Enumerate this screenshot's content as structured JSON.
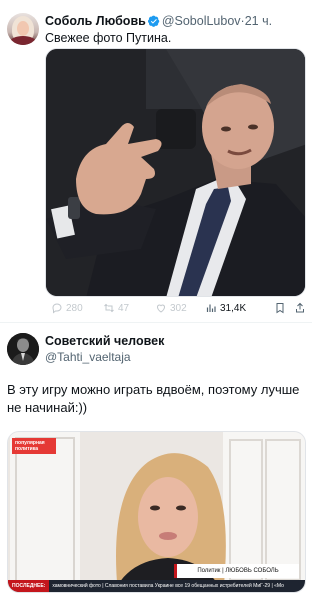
{
  "tweet": {
    "author_name": "Соболь Любовь",
    "handle": "@SobolLubov",
    "dot": "·",
    "time": "21 ч.",
    "text": "Свежее фото Путина.",
    "actions": {
      "reply_count": "280",
      "retweet_count": "47",
      "like_count": "302",
      "views_count": "31,4K"
    },
    "accent_color": "#1d9bf0"
  },
  "post2": {
    "author_name": "Советский человек",
    "handle": "@Tahti_vaeltaja",
    "text": "В эту игру можно играть вдвоём, поэтому лучше не начинай:))",
    "media": {
      "badge": "популярная политика",
      "ticker_label": "ПОСЛЕДНЕЕ:",
      "ticker_text": "хамовнический фото | Славония поставила Украине все 19 обещанных истребителей МиГ-29 | «Мо",
      "lower_third": "Политик | ЛЮБОВЬ СОБОЛЬ"
    }
  }
}
